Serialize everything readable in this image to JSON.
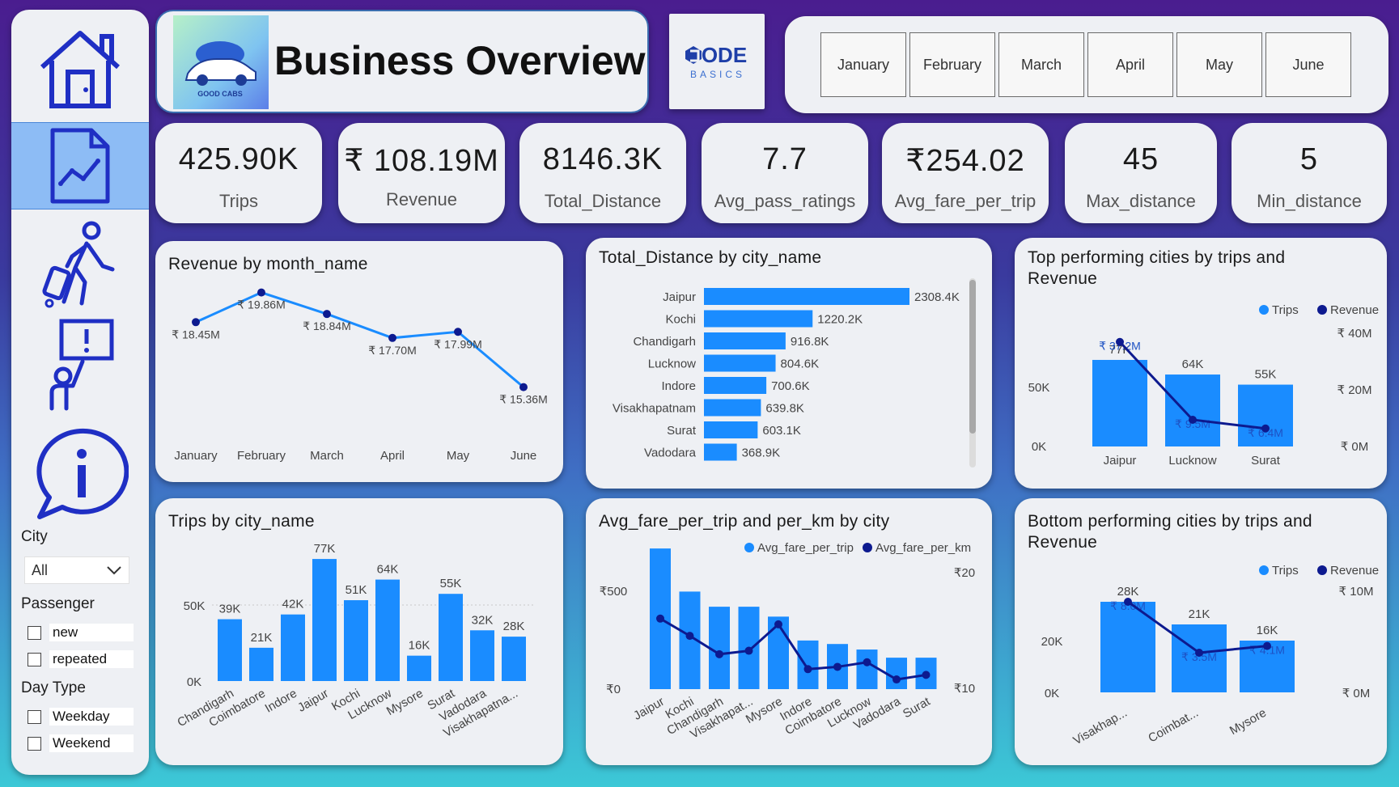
{
  "sidebar": {
    "nav": [
      "home",
      "trends",
      "travel",
      "alert",
      "info"
    ],
    "filters": {
      "city_label": "City",
      "city_value": "All",
      "passenger_label": "Passenger",
      "passenger_options": [
        "new",
        "repeated"
      ],
      "daytype_label": "Day Type",
      "daytype_options": [
        "Weekday",
        "Weekend"
      ]
    }
  },
  "header": {
    "title": "Business Overview",
    "logo_text": "GOOD CABS",
    "partner_logo": {
      "line1": "ODE",
      "line2": "BASICS"
    },
    "months": [
      "January",
      "February",
      "March",
      "April",
      "May",
      "June"
    ]
  },
  "kpis": [
    {
      "value": "425.90K",
      "label": "Trips"
    },
    {
      "value": "₹ 108.19M",
      "label": "Revenue"
    },
    {
      "value": "8146.3K",
      "label": "Total_Distance"
    },
    {
      "value": "7.7",
      "label": "Avg_pass_ratings"
    },
    {
      "value": "₹254.02",
      "label": "Avg_fare_per_trip"
    },
    {
      "value": "45",
      "label": "Max_distance"
    },
    {
      "value": "5",
      "label": "Min_distance"
    }
  ],
  "colors": {
    "bar": "#1a8cff",
    "line": "#1a8cff",
    "dark": "#0d1a8f",
    "text": "#444444"
  },
  "chart_data": [
    {
      "id": "revenue_month",
      "type": "line",
      "title": "Revenue by month_name",
      "categories": [
        "January",
        "February",
        "March",
        "April",
        "May",
        "June"
      ],
      "values": [
        18.45,
        19.86,
        18.84,
        17.7,
        17.99,
        15.36
      ],
      "labels": [
        "₹ 18.45M",
        "₹ 19.86M",
        "₹ 18.84M",
        "₹ 17.70M",
        "₹ 17.99M",
        "₹ 15.36M"
      ]
    },
    {
      "id": "distance_city",
      "type": "bar",
      "orientation": "horizontal",
      "title": "Total_Distance by city_name",
      "categories": [
        "Jaipur",
        "Kochi",
        "Chandigarh",
        "Lucknow",
        "Indore",
        "Visakhapatnam",
        "Surat",
        "Vadodara"
      ],
      "values": [
        2308.4,
        1220.2,
        916.8,
        804.6,
        700.6,
        639.8,
        603.1,
        368.9
      ],
      "labels": [
        "2308.4K",
        "1220.2K",
        "916.8K",
        "804.6K",
        "700.6K",
        "639.8K",
        "603.1K",
        "368.9K"
      ]
    },
    {
      "id": "top_cities",
      "type": "bar",
      "title": "Top performing cities by trips and Revenue",
      "legend": [
        "Trips",
        "Revenue"
      ],
      "categories": [
        "Jaipur",
        "Lucknow",
        "Surat"
      ],
      "trips": [
        77,
        64,
        55
      ],
      "trip_labels": [
        "77K",
        "64K",
        "55K"
      ],
      "revenue": [
        37.2,
        9.5,
        6.4
      ],
      "revenue_labels": [
        "₹ 37.2M",
        "₹ 9.5M",
        "₹ 6.4M"
      ],
      "left_ticks": [
        "50K",
        "0K"
      ],
      "right_ticks": [
        "₹ 40M",
        "₹ 20M",
        "₹ 0M"
      ]
    },
    {
      "id": "trips_city",
      "type": "bar",
      "title": "Trips by city_name",
      "categories": [
        "Chandigarh",
        "Coimbatore",
        "Indore",
        "Jaipur",
        "Kochi",
        "Lucknow",
        "Mysore",
        "Surat",
        "Vadodara",
        "Visakhapatna..."
      ],
      "values": [
        39,
        21,
        42,
        77,
        51,
        64,
        16,
        55,
        32,
        28
      ],
      "labels": [
        "39K",
        "21K",
        "42K",
        "77K",
        "51K",
        "64K",
        "16K",
        "55K",
        "32K",
        "28K"
      ],
      "ticks": [
        "50K",
        "0K"
      ]
    },
    {
      "id": "fare_city",
      "type": "bar",
      "title": "Avg_fare_per_trip and per_km by city",
      "legend": [
        "Avg_fare_per_trip",
        "Avg_fare_per_km"
      ],
      "categories": [
        "Jaipur",
        "Kochi",
        "Chandigarh",
        "Visakhapat...",
        "Mysore",
        "Indore",
        "Coimbatore",
        "Lucknow",
        "Vadodara",
        "Surat"
      ],
      "fare_trip": [
        483,
        335,
        283,
        283,
        249,
        167,
        155,
        136,
        108,
        108
      ],
      "fare_km": [
        16.0,
        14.5,
        12.9,
        13.2,
        15.5,
        11.6,
        11.8,
        12.2,
        10.7,
        11.1
      ],
      "left_ticks": [
        "₹500",
        "₹0"
      ],
      "right_ticks": [
        "₹20",
        "₹10"
      ]
    },
    {
      "id": "bottom_cities",
      "type": "bar",
      "title": "Bottom performing cities by trips and Revenue",
      "legend": [
        "Trips",
        "Revenue"
      ],
      "categories": [
        "Visakhap...",
        "Coimbat...",
        "Mysore"
      ],
      "trips": [
        28,
        21,
        16
      ],
      "trip_labels": [
        "28K",
        "21K",
        "16K"
      ],
      "revenue": [
        8.0,
        3.5,
        4.1
      ],
      "revenue_labels": [
        "₹ 8.0M",
        "₹ 3.5M",
        "₹ 4.1M"
      ],
      "left_ticks": [
        "20K",
        "0K"
      ],
      "right_ticks": [
        "₹ 10M",
        "₹ 0M"
      ]
    }
  ]
}
